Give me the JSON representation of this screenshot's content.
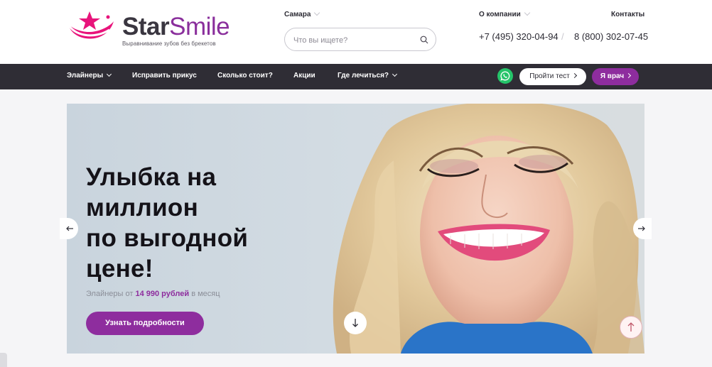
{
  "brand": {
    "name_part1": "Star",
    "name_part2": "Smile",
    "tagline": "Выравнивание зубов без брекетов",
    "colors": {
      "pink": "#e8147b",
      "purple": "#8e2d9e",
      "dark": "#2f2d35"
    }
  },
  "header": {
    "city": "Самара",
    "search_placeholder": "Что вы ищете?",
    "about": "О компании",
    "contacts": "Контакты",
    "phone1": "+7 (495) 320-04-94",
    "phone_separator": "/",
    "phone2": "8 (800) 302-07-45"
  },
  "nav": {
    "items": [
      {
        "label": "Элайнеры",
        "has_dropdown": true
      },
      {
        "label": "Исправить прикус",
        "has_dropdown": false
      },
      {
        "label": "Сколько стоит?",
        "has_dropdown": false
      },
      {
        "label": "Акции",
        "has_dropdown": false
      },
      {
        "label": "Где лечиться?",
        "has_dropdown": true
      }
    ],
    "whatsapp_icon": "whatsapp-icon",
    "test_button": "Пройти тест",
    "doctor_button": "Я врач"
  },
  "hero": {
    "title_line1": "Улыбка на",
    "title_line2": "миллион",
    "title_line3": "по выгодной",
    "title_line4": "цене!",
    "subtitle_before": "Элайнеры от",
    "subtitle_price": "14 990 рублей",
    "subtitle_after": "в месяц",
    "cta": "Узнать подробности"
  }
}
